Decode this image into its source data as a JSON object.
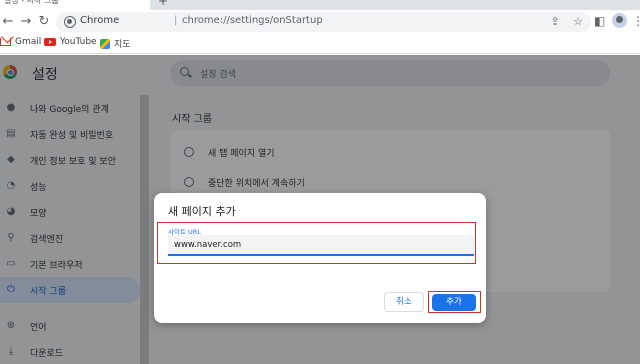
{
  "browser": {
    "tab_label": "설정 - 시작 그룹",
    "new_tab_glyph": "+",
    "omnibox_brand": "Chrome",
    "omnibox_separator": "|",
    "url": "chrome://settings/onStartup"
  },
  "bookmarks": [
    {
      "label": "Gmail",
      "icon": "gmail-icon"
    },
    {
      "label": "YouTube",
      "icon": "youtube-icon"
    },
    {
      "label": "지도",
      "icon": "maps-icon"
    }
  ],
  "settings": {
    "title": "설정",
    "search_placeholder": "설정 검색",
    "sidebar": [
      {
        "label": "나와 Google의 관계",
        "icon": "person-icon",
        "glyph": "●"
      },
      {
        "label": "자동 완성 및 비밀번호",
        "icon": "clipboard-icon",
        "glyph": "▤"
      },
      {
        "label": "개인 정보 보호 및 보안",
        "icon": "shield-icon",
        "glyph": "◆"
      },
      {
        "label": "성능",
        "icon": "gauge-icon",
        "glyph": "◔"
      },
      {
        "label": "모양",
        "icon": "palette-icon",
        "glyph": "◕"
      },
      {
        "label": "검색엔진",
        "icon": "search-icon",
        "glyph": "⚲"
      },
      {
        "label": "기본 브라우저",
        "icon": "browser-icon",
        "glyph": "▭"
      },
      {
        "label": "시작 그룹",
        "icon": "power-icon",
        "glyph": "⏻",
        "active": true
      },
      {
        "label": "언어",
        "icon": "globe-icon",
        "glyph": "⊕"
      },
      {
        "label": "다운로드",
        "icon": "download-icon",
        "glyph": "⤓"
      }
    ],
    "section_title": "시작 그룹",
    "startup_options": [
      {
        "label": "새 탭 페이지 열기"
      },
      {
        "label": "중단한 위치에서 계속하기"
      }
    ]
  },
  "dialog": {
    "title": "새 페이지 추가",
    "field_label": "사이트 URL",
    "field_value": "www.naver.com",
    "cancel_label": "취소",
    "add_label": "추가"
  }
}
